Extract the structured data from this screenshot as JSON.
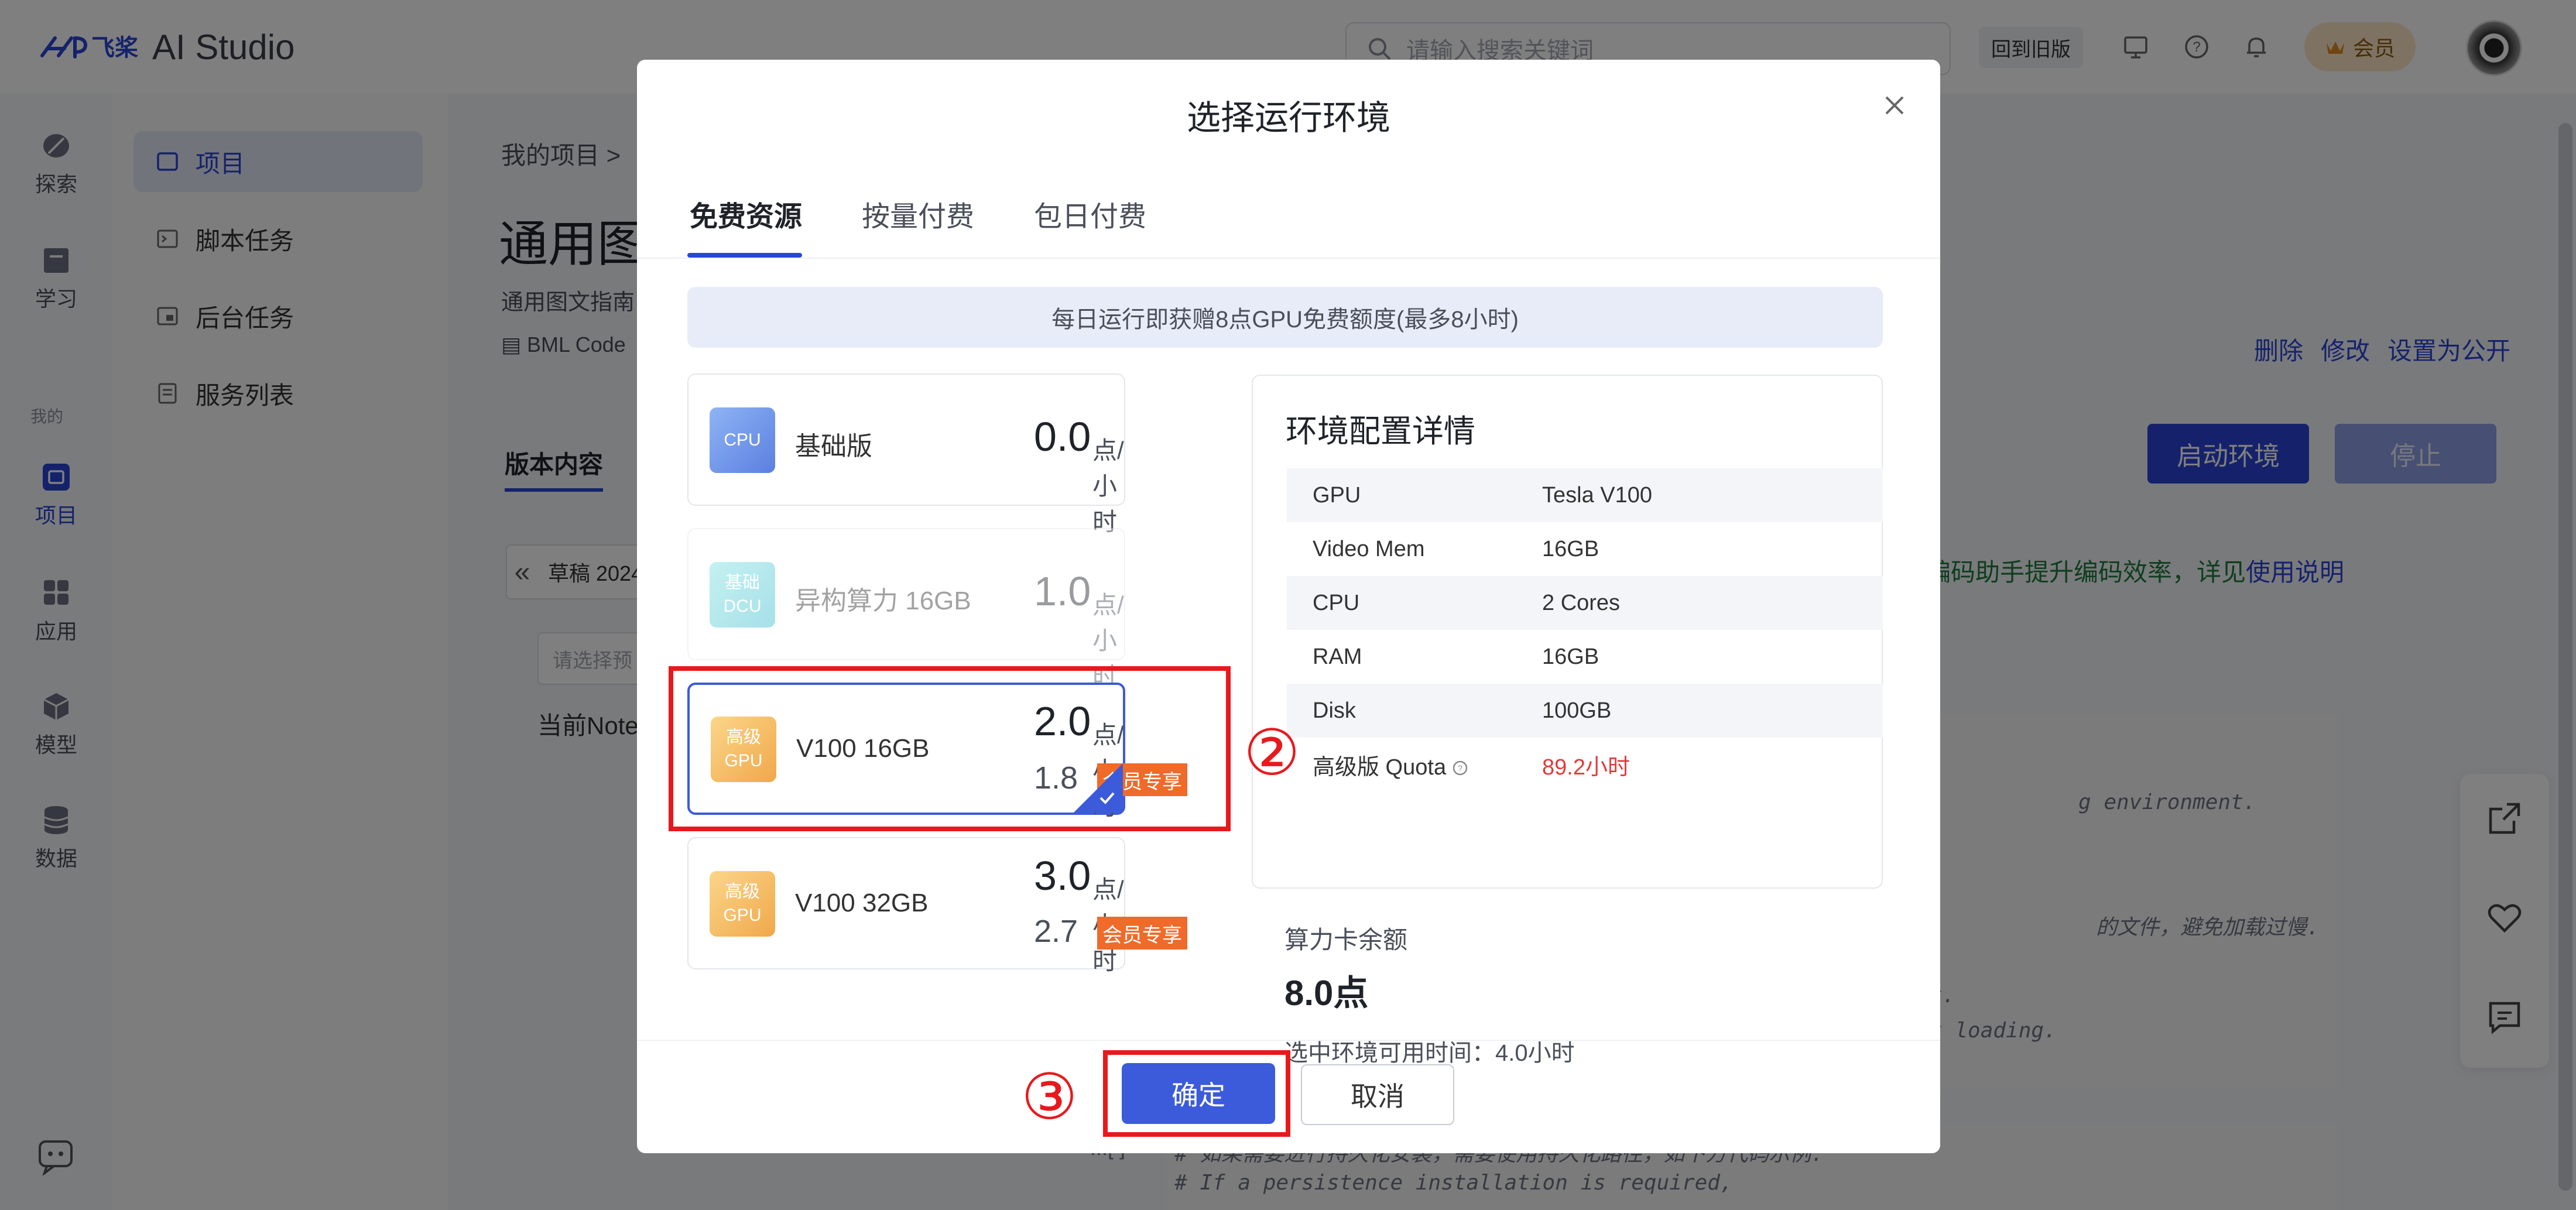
{
  "app": {
    "logo_text": "飞桨",
    "logo_suffix": "AI Studio",
    "search_placeholder": "请输入搜索关键词",
    "old_version_label": "回到旧版",
    "vip_label": "会员"
  },
  "sidebar": {
    "items": [
      {
        "label": "探索",
        "icon": "compass-icon"
      },
      {
        "label": "学习",
        "icon": "book-icon"
      },
      {
        "label": "项目",
        "icon": "project-icon"
      },
      {
        "label": "应用",
        "icon": "apps-icon"
      },
      {
        "label": "模型",
        "icon": "cube-icon"
      },
      {
        "label": "数据",
        "icon": "database-icon"
      }
    ],
    "section_label": "我的"
  },
  "subnav": {
    "items": [
      {
        "label": "项目",
        "active": true
      },
      {
        "label": "脚本任务",
        "active": false
      },
      {
        "label": "后台任务",
        "active": false
      },
      {
        "label": "服务列表",
        "active": false
      }
    ]
  },
  "page": {
    "breadcrumb": "我的项目 >",
    "title": "通用图",
    "subtitle": "通用图文指南",
    "meta": "BML Code",
    "actions": [
      "删除",
      "修改",
      "设置为公开"
    ],
    "start_label": "启动环境",
    "stop_label": "停止",
    "version_tab": "版本内容",
    "hint": "编码助手提升编码效率，详见",
    "hint_link": "使用说明",
    "draft_label": "草稿 2024",
    "preset_placeholder": "请选择预",
    "current_note": "当前Note",
    "code_lines": [
      "g environment.",
      "的文件，避免加载过慢.",
      "t.",
      "t loading.",
      "# 如果需要进行持久化安装，需要使用持久化路径，如下方代码示例:",
      "# If a persistence installation is required,"
    ],
    "code_ellipsis": "...[ ]"
  },
  "modal": {
    "title": "选择运行环境",
    "tabs": [
      "免费资源",
      "按量付费",
      "包日付费"
    ],
    "active_tab": 0,
    "banner": "每日运行即获赠8点GPU免费额度(最多8小时)",
    "cards": [
      {
        "icon_text": "CPU",
        "name": "基础版",
        "price": "0.0",
        "unit": "点/小时",
        "vip_price": "",
        "vip_badge": "",
        "state": "normal"
      },
      {
        "icon_text": "基础 DCU",
        "name": "异构算力 16GB",
        "price": "1.0",
        "unit": "点/小时",
        "vip_price": "",
        "vip_badge": "",
        "state": "disabled"
      },
      {
        "icon_text": "高级 GPU",
        "name": "V100 16GB",
        "price": "2.0",
        "unit": "点/小时",
        "vip_price": "1.8",
        "vip_badge": "会员专享",
        "state": "selected"
      },
      {
        "icon_text": "高级 GPU",
        "name": "V100 32GB",
        "price": "3.0",
        "unit": "点/小时",
        "vip_price": "2.7",
        "vip_badge": "会员专享",
        "state": "normal"
      }
    ],
    "detail": {
      "title": "环境配置详情",
      "rows": [
        {
          "key": "GPU",
          "value": "Tesla V100"
        },
        {
          "key": "Video Mem",
          "value": "16GB"
        },
        {
          "key": "CPU",
          "value": "2 Cores"
        },
        {
          "key": "RAM",
          "value": "16GB"
        },
        {
          "key": "Disk",
          "value": "100GB"
        },
        {
          "key": "高级版 Quota",
          "value": "89.2小时"
        }
      ]
    },
    "balance_label": "算力卡余额",
    "balance_value": "8.0点",
    "available_time": "选中环境可用时间：4.0小时",
    "ok_label": "确定",
    "cancel_label": "取消"
  },
  "annotations": {
    "step2": "②",
    "step3": "③"
  },
  "colors": {
    "accent": "#3b5bdb",
    "vip_badge": "#f06a2a",
    "highlight": "#e8191c",
    "quota_value": "#e23b3b"
  }
}
